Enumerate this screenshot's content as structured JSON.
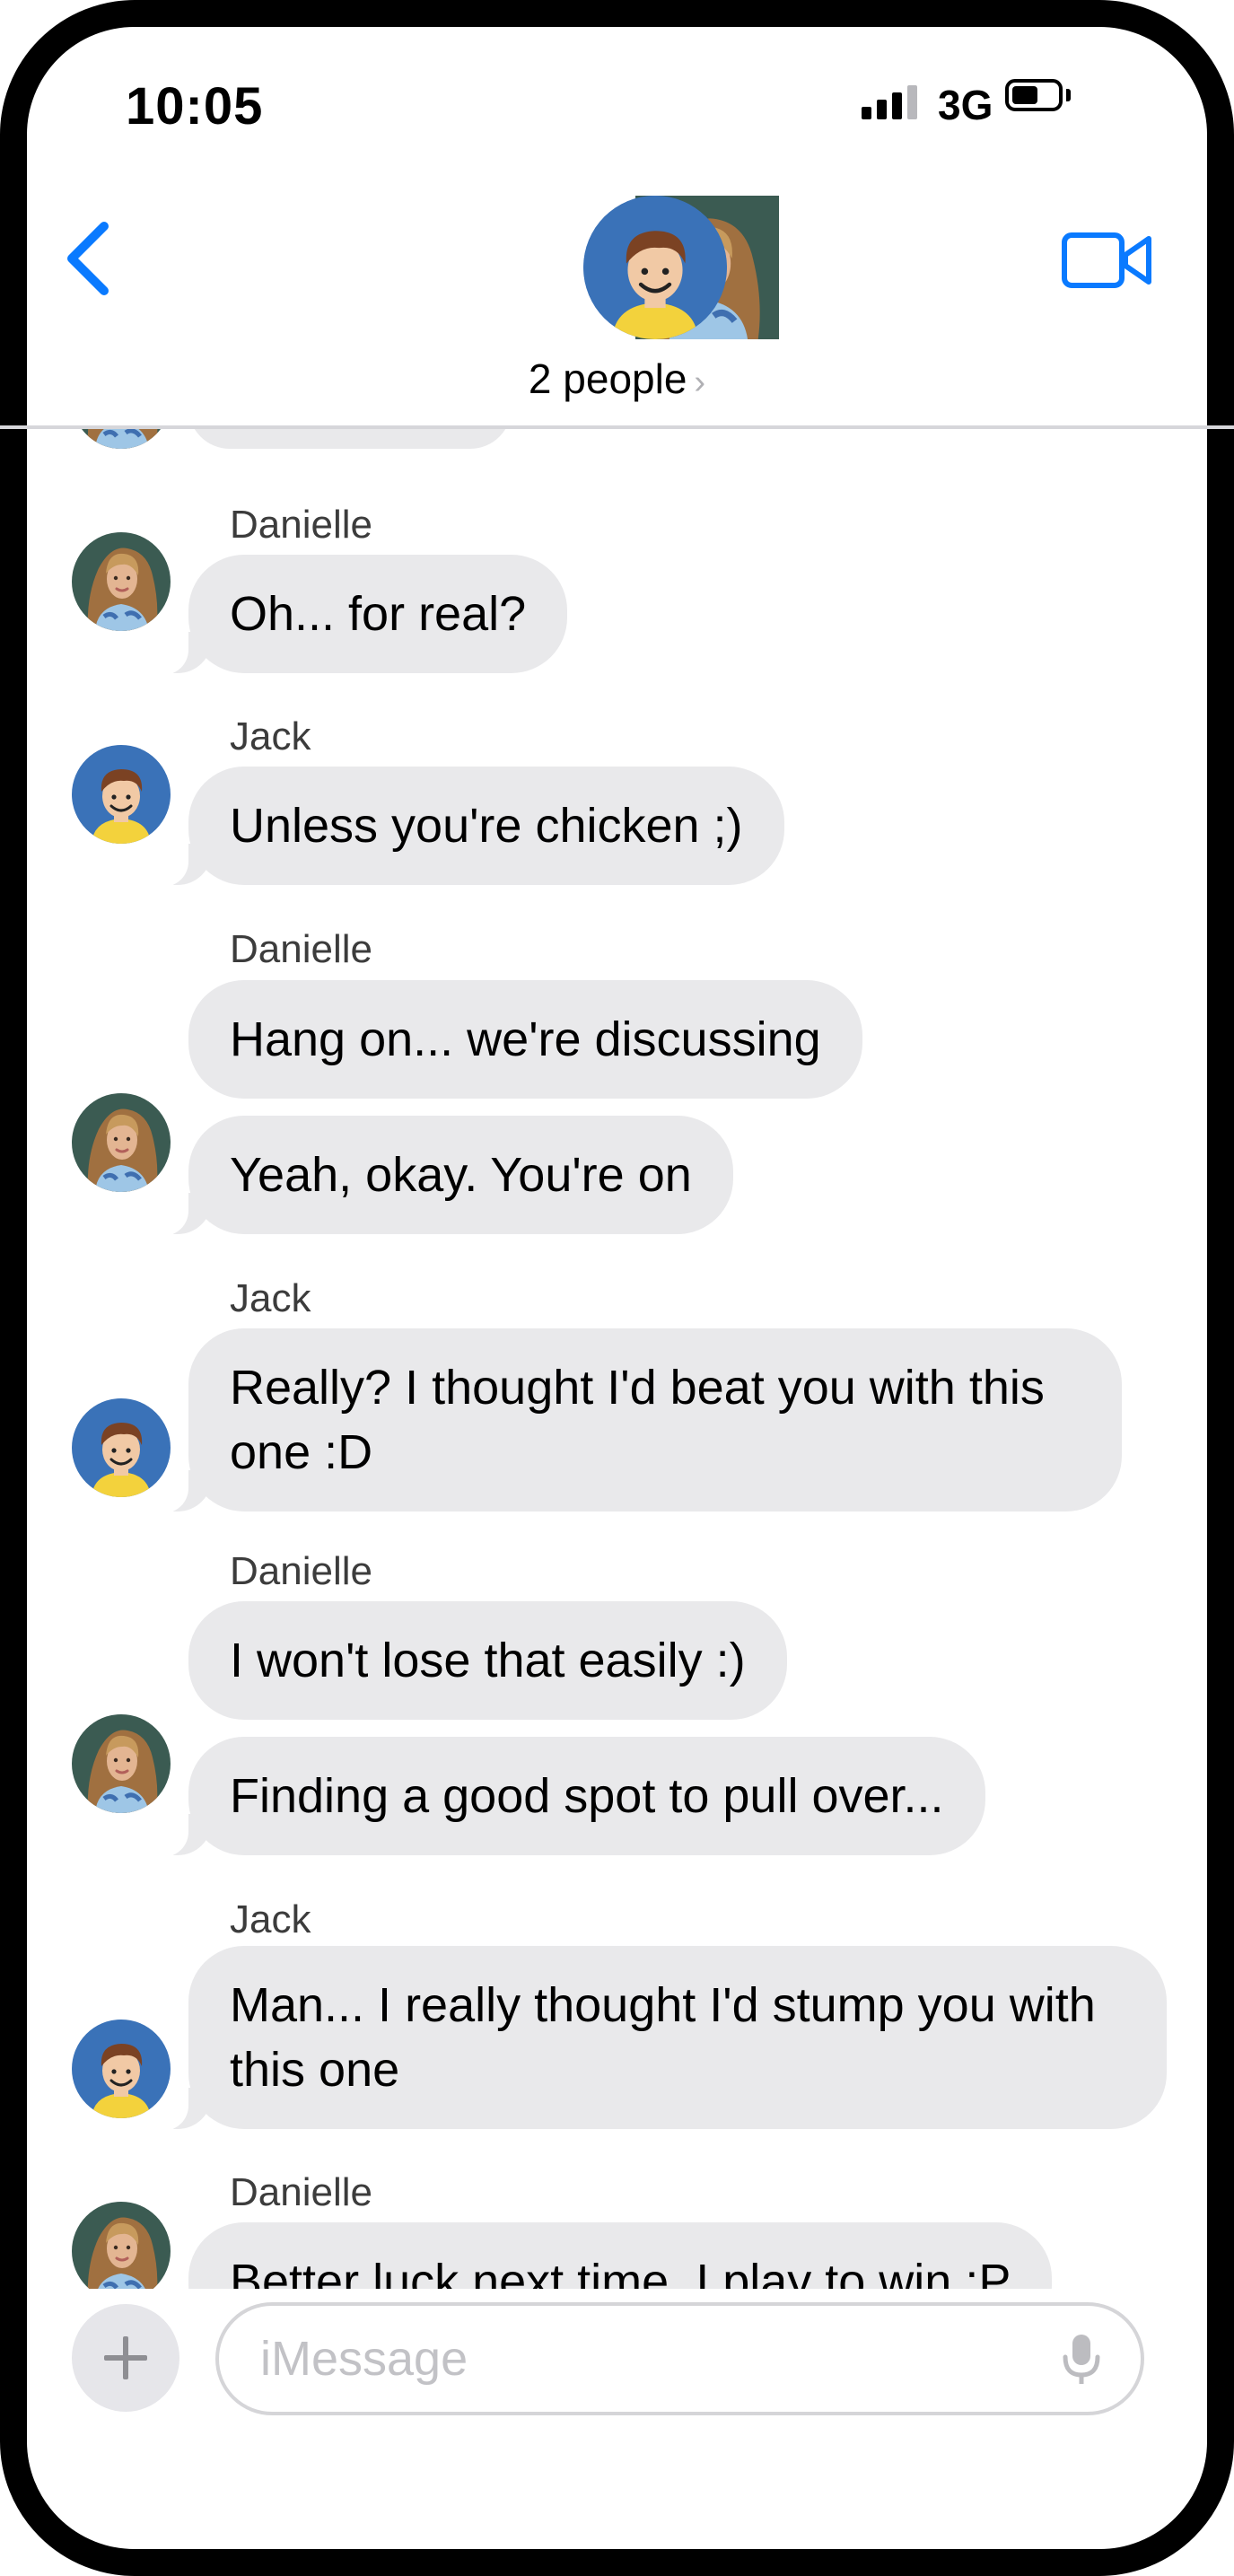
{
  "status_bar": {
    "time": "10:05",
    "network": "3G"
  },
  "header": {
    "people_label": "2 people",
    "chevron": "›"
  },
  "colors": {
    "accent": "#0a7aff",
    "bubble": "#e9e9eb",
    "avatar_blue": "#3a72b8"
  },
  "messages": [
    {
      "sender": "Danielle",
      "text": "Oh... for real?"
    },
    {
      "sender": "Jack",
      "text": "Unless you're chicken ;)"
    },
    {
      "sender": "Danielle",
      "text": "Hang on... we're discussing"
    },
    {
      "sender": "",
      "text": "Yeah, okay.  You're on"
    },
    {
      "sender": "Jack",
      "text": "Really?  I thought I'd beat you with this",
      "text2": "one :D"
    },
    {
      "sender": "Danielle",
      "text": "I won't lose that easily :)"
    },
    {
      "sender": "",
      "text": "Finding a good spot to pull over..."
    },
    {
      "sender": "Jack",
      "text": "Man... I really thought I'd stump you with",
      "text2": "this one"
    },
    {
      "sender": "Danielle",
      "text": "Better luck next time.  I play to win :P"
    }
  ],
  "input": {
    "placeholder": "iMessage"
  },
  "icons": {
    "back": "chevron-left-icon",
    "video": "video-camera-icon",
    "plus": "plus-icon",
    "mic": "microphone-icon",
    "signal": "cellular-signal-icon",
    "battery": "battery-icon"
  }
}
